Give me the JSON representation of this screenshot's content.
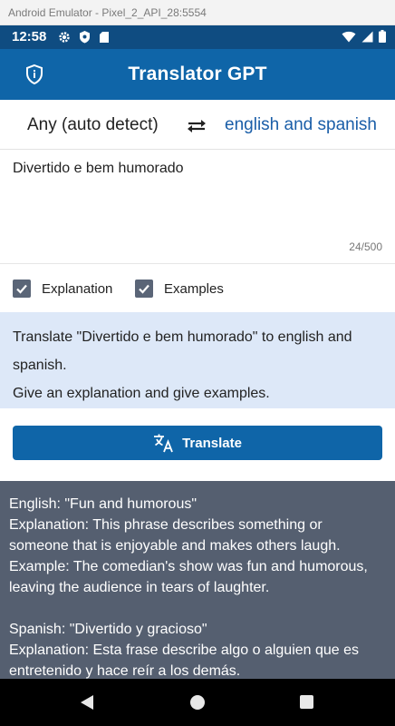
{
  "emulator": {
    "title": "Android Emulator - Pixel_2_API_28:5554"
  },
  "status_bar": {
    "time": "12:58"
  },
  "app_bar": {
    "title": "Translator GPT"
  },
  "languages": {
    "source": "Any (auto detect)",
    "target": "english and spanish"
  },
  "input": {
    "value": "Divertido e bem humorado",
    "char_count": "24/500"
  },
  "options": [
    {
      "label": "Explanation",
      "checked": true
    },
    {
      "label": "Examples",
      "checked": true
    }
  ],
  "prompt": {
    "line1": "Translate \"Divertido e bem humorado\" to english and",
    "line2": "spanish.",
    "line3": "Give an explanation and give examples."
  },
  "translate_button": {
    "label": "Translate"
  },
  "result": {
    "lines": [
      "English: \"Fun and humorous\"",
      "Explanation: This phrase describes something or",
      "someone that is enjoyable and makes others laugh.",
      "Example: The comedian's show was fun and humorous,",
      "leaving the audience in tears of laughter.",
      "",
      "Spanish: \"Divertido y gracioso\"",
      "Explanation: Esta frase describe algo o alguien que es",
      "entretenido y hace reír a los demás."
    ]
  },
  "colors": {
    "status_bar": "#0f4c81",
    "app_bar": "#0f65a8",
    "target_language": "#1a5ea8",
    "prompt_background": "#dde8f8",
    "result_background": "#555f70"
  },
  "icons": [
    "shield-info-icon",
    "swap-icon",
    "translate-icon",
    "checkbox-checked-icon",
    "gear-icon",
    "play-protect-icon",
    "sd-card-icon",
    "wifi-icon",
    "signal-icon",
    "battery-icon",
    "back-icon",
    "home-icon",
    "recents-icon"
  ]
}
